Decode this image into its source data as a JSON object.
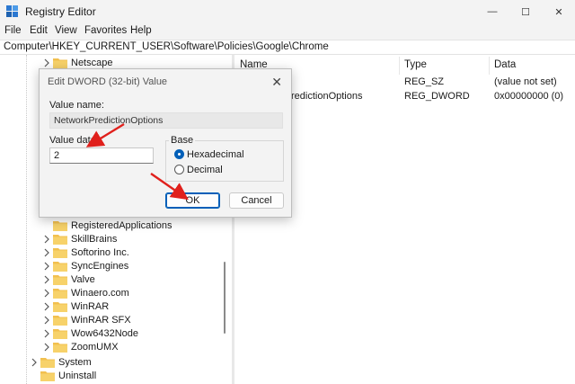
{
  "window": {
    "title": "Registry Editor",
    "minimize_glyph": "—",
    "maximize_glyph": "☐",
    "close_glyph": "✕",
    "icon": "registry-editor-icon"
  },
  "menu": [
    "File",
    "Edit",
    "View",
    "Favorites",
    "Help"
  ],
  "address": "Computer\\HKEY_CURRENT_USER\\Software\\Policies\\Google\\Chrome",
  "tree": {
    "items": [
      {
        "label": "Netscape"
      },
      {
        "label": "RegisteredApplications"
      },
      {
        "label": "SkillBrains"
      },
      {
        "label": "Softorino Inc."
      },
      {
        "label": "SyncEngines"
      },
      {
        "label": "Valve"
      },
      {
        "label": "Winaero.com"
      },
      {
        "label": "WinRAR"
      },
      {
        "label": "WinRAR SFX"
      },
      {
        "label": "Wow6432Node"
      },
      {
        "label": "ZoomUMX"
      },
      {
        "label": "System"
      },
      {
        "label": "Uninstall"
      }
    ]
  },
  "values_pane": {
    "columns": [
      "Name",
      "Type",
      "Data"
    ],
    "rows": [
      {
        "name": "",
        "type": "REG_SZ",
        "data": "(value not set)"
      },
      {
        "name": "redictionOptions",
        "type": "REG_DWORD",
        "data": "0x00000000 (0)"
      }
    ]
  },
  "dialog": {
    "title": "Edit DWORD (32-bit) Value",
    "close_glyph": "✕",
    "value_name_label": "Value name:",
    "value_name": "NetworkPredictionOptions",
    "value_data_label": "Value data:",
    "value_data": "2",
    "base_label": "Base",
    "base_options": [
      "Hexadecimal",
      "Decimal"
    ],
    "base_selected": "Hexadecimal",
    "ok_label": "OK",
    "cancel_label": "Cancel"
  },
  "colors": {
    "accent": "#005fb8",
    "annotation_arrow": "#e0201c",
    "folder": "#f2c04f"
  }
}
